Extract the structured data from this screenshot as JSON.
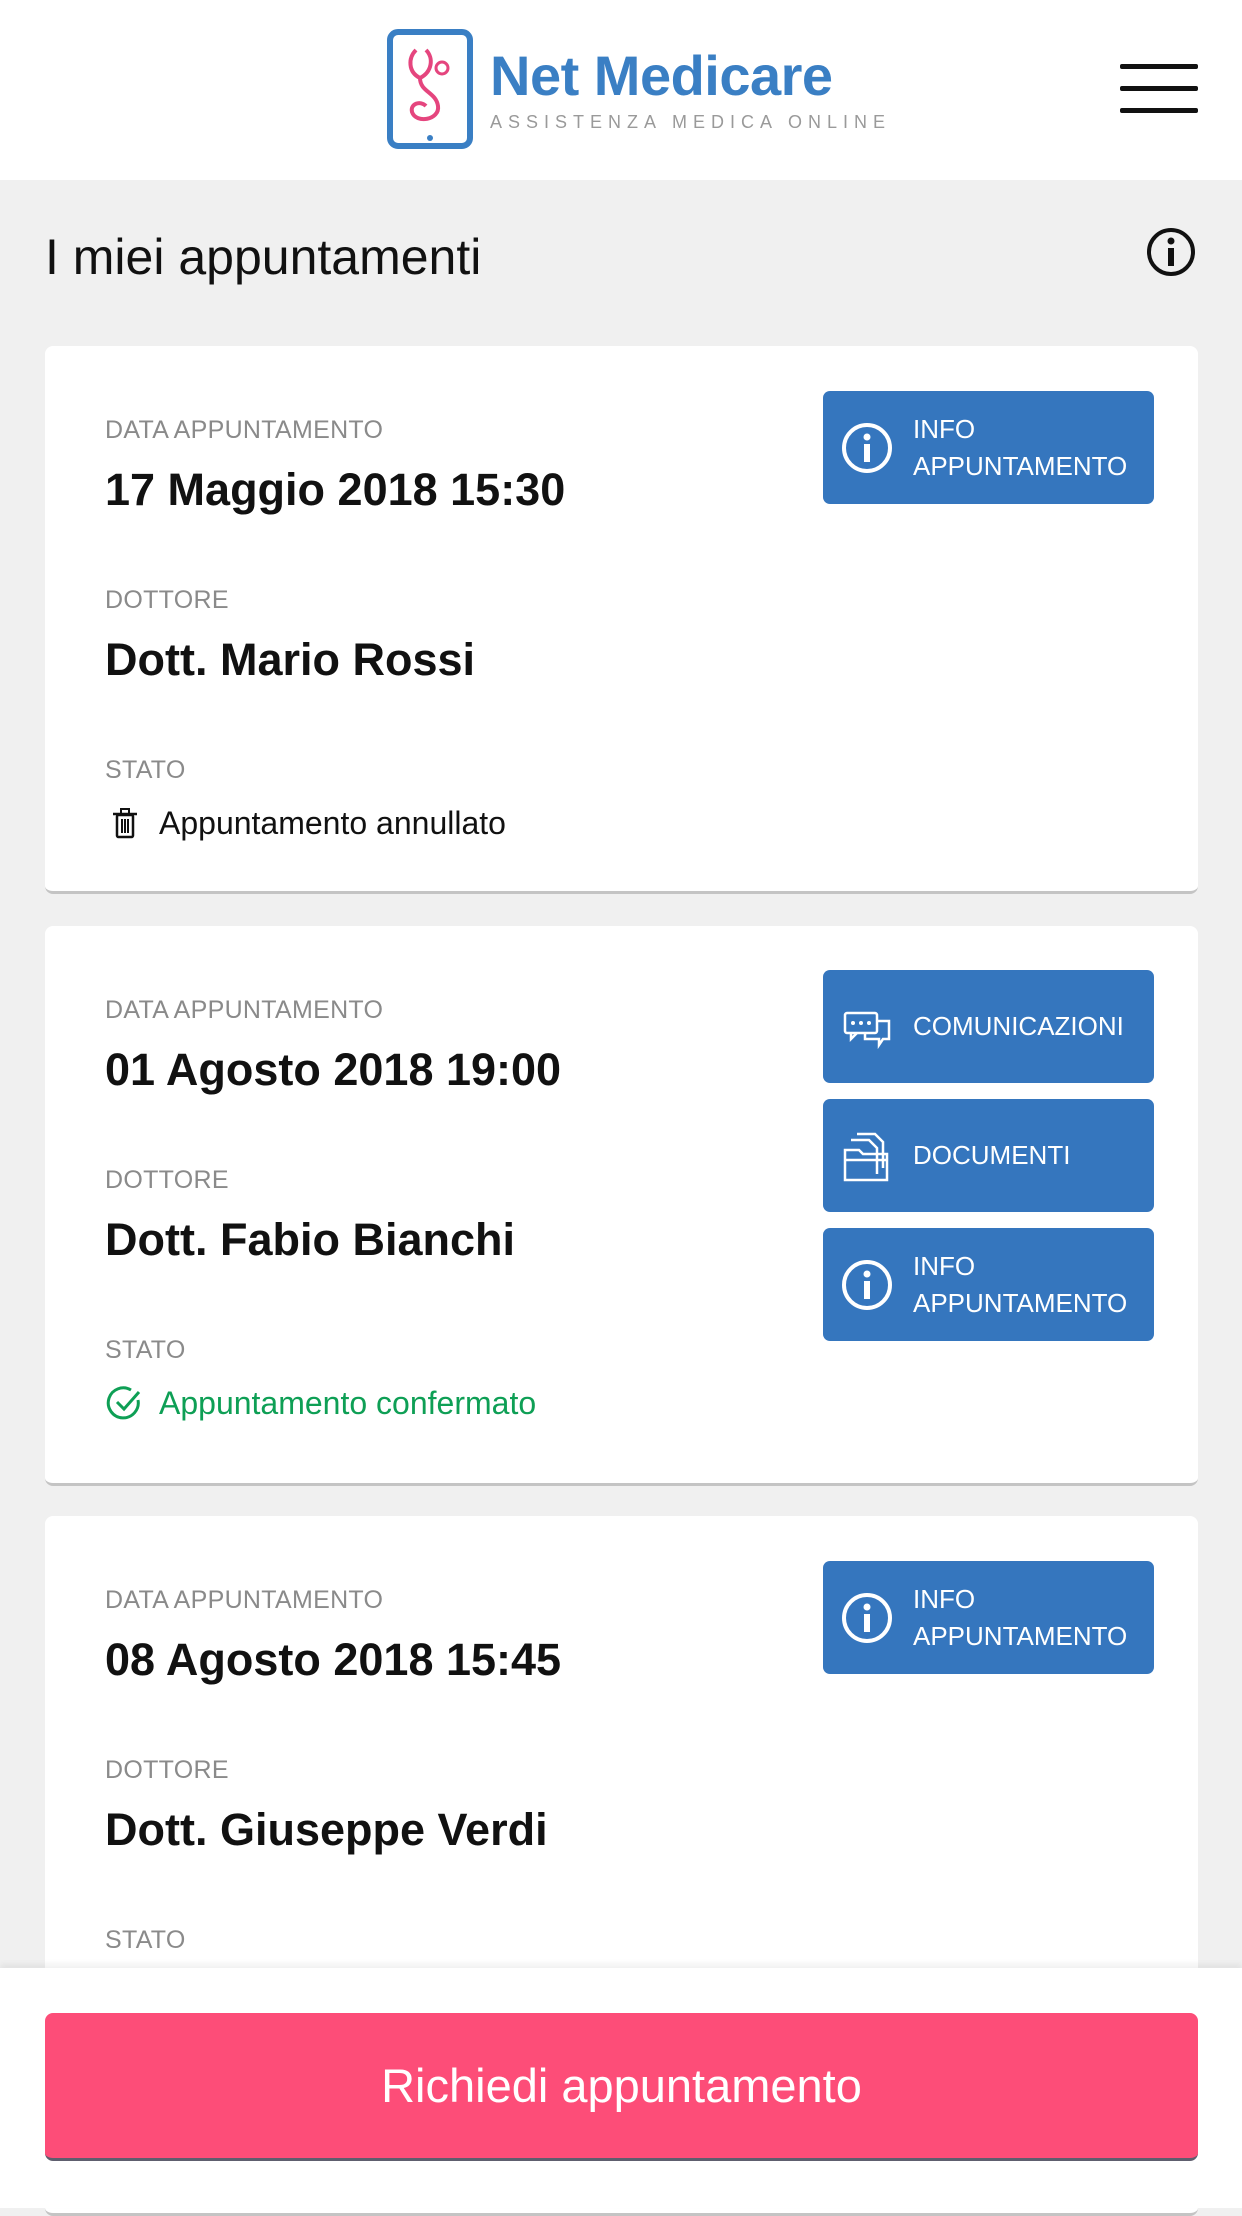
{
  "header": {
    "brand_title": "Net Medicare",
    "brand_subtitle": "ASSISTENZA MEDICA ONLINE",
    "menu_icon": "hamburger-menu-icon",
    "brand_color": "#3a7fc4"
  },
  "page": {
    "title": "I miei appuntamenti",
    "info_icon": "info-circle-icon"
  },
  "labels": {
    "date": "DATA APPUNTAMENTO",
    "doctor": "DOTTORE",
    "status": "STATO"
  },
  "appointments": [
    {
      "date": "17 Maggio 2018 15:30",
      "doctor": "Dott. Mario Rossi",
      "status": "Appuntamento annullato",
      "status_icon": "trash-icon",
      "buttons": [
        {
          "icon": "info-circle-icon",
          "label": "INFO\nAPPUNTAMENTO"
        }
      ]
    },
    {
      "date": "01 Agosto 2018 19:00",
      "doctor": "Dott. Fabio Bianchi",
      "status": "Appuntamento confermato",
      "status_icon": "check-circle-icon",
      "status_color": "#0e9f55",
      "buttons": [
        {
          "icon": "chat-bubbles-icon",
          "label": "COMUNICAZIONI"
        },
        {
          "icon": "folders-icon",
          "label": "DOCUMENTI"
        },
        {
          "icon": "info-circle-icon",
          "label": "INFO\nAPPUNTAMENTO"
        }
      ]
    },
    {
      "date": "08 Agosto 2018 15:45",
      "doctor": "Dott. Giuseppe Verdi",
      "buttons": [
        {
          "icon": "info-circle-icon",
          "label": "INFO\nAPPUNTAMENTO"
        }
      ]
    }
  ],
  "cta": {
    "label": "Richiedi appuntamento",
    "color": "#fd4d78"
  },
  "colors": {
    "button_blue": "#3576be",
    "background": "#f0f0f0"
  }
}
